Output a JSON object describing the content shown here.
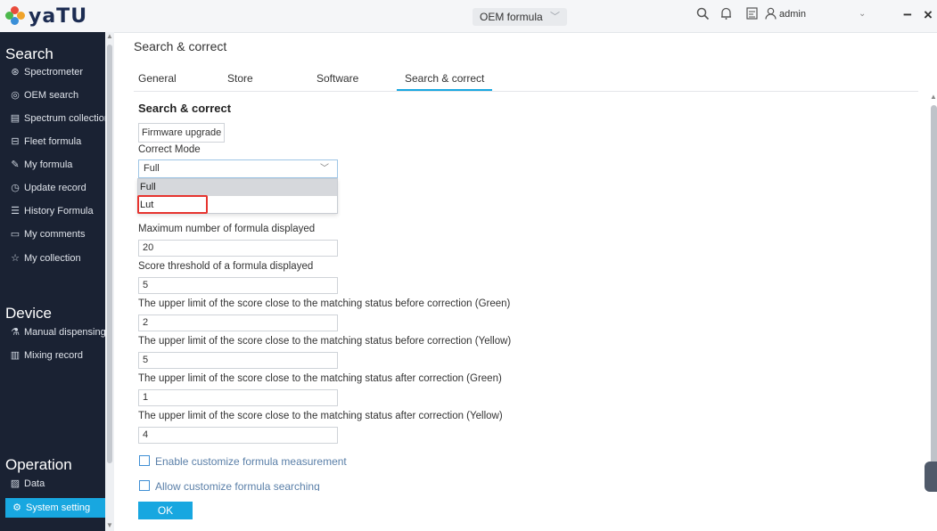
{
  "app": {
    "logo_text": "yaTU",
    "formula_select": "OEM formula",
    "user": "admin",
    "minimize": "−",
    "close": "×"
  },
  "sidebar": {
    "sections": [
      {
        "title": "Search",
        "items": [
          {
            "label": "Spectrometer",
            "icon": "spectrometer-icon"
          },
          {
            "label": "OEM search",
            "icon": "oem-icon"
          },
          {
            "label": "Spectrum collection",
            "icon": "collection-icon"
          },
          {
            "label": "Fleet formula",
            "icon": "car-icon"
          },
          {
            "label": "My formula",
            "icon": "edit-icon"
          },
          {
            "label": "Update record",
            "icon": "clock-icon"
          },
          {
            "label": "History Formula",
            "icon": "history-icon"
          },
          {
            "label": "My comments",
            "icon": "comment-icon"
          },
          {
            "label": "My collection",
            "icon": "star-icon"
          }
        ]
      },
      {
        "title": "Device",
        "items": [
          {
            "label": "Manual dispensing",
            "icon": "dispense-icon"
          },
          {
            "label": "Mixing record",
            "icon": "record-icon"
          }
        ]
      },
      {
        "title": "Operation",
        "items": [
          {
            "label": "Data",
            "icon": "chart-icon"
          },
          {
            "label": "System setting",
            "icon": "gear-icon"
          }
        ]
      }
    ]
  },
  "main": {
    "page_title": "Search & correct",
    "tabs": [
      "General",
      "Store",
      "Software",
      "Search & correct"
    ],
    "active_tab": "Search & correct",
    "section_title": "Search & correct",
    "firmware_button": "Firmware upgrade",
    "correct_mode": {
      "label": "Correct Mode",
      "value": "Full",
      "options": [
        "Full",
        "Lut"
      ]
    },
    "fields": [
      {
        "label": "Maximum number of formula displayed",
        "value": "20"
      },
      {
        "label": "Score threshold of a formula displayed",
        "value": "5"
      },
      {
        "label": "The upper limit of the score close to the matching status before correction (Green)",
        "value": "2"
      },
      {
        "label": "The upper limit of the score close to the matching status before correction (Yellow)",
        "value": "5"
      },
      {
        "label": "The upper limit of the score close to the matching status after correction (Green)",
        "value": "1"
      },
      {
        "label": "The upper limit of the score close to the matching status after correction (Yellow)",
        "value": "4"
      }
    ],
    "checkboxes": [
      {
        "label": "Enable customize formula measurement",
        "checked": false
      },
      {
        "label": "Allow customize formula searching",
        "checked": false
      }
    ],
    "ok_button": "OK"
  },
  "colors": {
    "accent": "#18a7e0",
    "sidebar_bg": "#1a2233",
    "highlight_box": "#e6342f"
  }
}
